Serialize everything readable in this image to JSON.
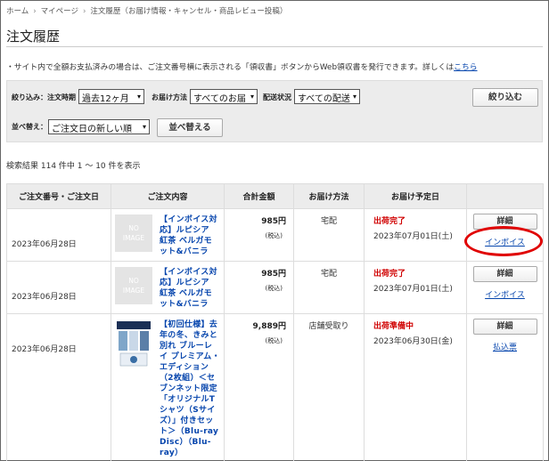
{
  "breadcrumb": {
    "home": "ホーム",
    "mypage": "マイページ",
    "current": "注文履歴（お届け情報・キャンセル・商品レビュー投稿）"
  },
  "page_title": "注文履歴",
  "notice": {
    "text": "・サイト内で全額お支払済みの場合は、ご注文番号横に表示される「領収書」ボタンからWeb領収書を発行できます。詳しくは",
    "link": "こちら"
  },
  "filter": {
    "label": "絞り込み：",
    "period_label": "注文時期",
    "period_value": "過去12ヶ月",
    "method_label": "お届け方法",
    "method_value": "すべてのお届",
    "status_label": "配送状況",
    "status_value": "すべての配送",
    "apply_label": "絞り込む",
    "sort_label": "並べ替え：",
    "sort_value": "ご注文日の新しい順",
    "sort_button": "並べ替える"
  },
  "result_count": "検索結果 114 件中 1 〜 10 件を表示",
  "table": {
    "headers": [
      "ご注文番号・ご注文日",
      "ご注文内容",
      "合計金額",
      "お届け方法",
      "お届け予定日",
      ""
    ],
    "rows": [
      {
        "date": "2023年06月28日",
        "image": "NO IMAGE",
        "item": "【インボイス対応】ルピシア 紅茶 ベルガモット&バニラ",
        "price": "985円",
        "tax": "(税込)",
        "method": "宅配",
        "status": "出荷完了",
        "delivery": "2023年07月01日(土)",
        "detail_label": "詳細",
        "link_label": "インボイス"
      },
      {
        "date": "2023年06月28日",
        "image": "NO IMAGE",
        "item": "【インボイス対応】ルピシア 紅茶 ベルガモット&バニラ",
        "price": "985円",
        "tax": "(税込)",
        "method": "宅配",
        "status": "出荷完了",
        "delivery": "2023年07月01日(土)",
        "detail_label": "詳細",
        "link_label": "インボイス"
      },
      {
        "date": "2023年06月28日",
        "image": "",
        "item": "【初回仕様】去年の冬、きみと別れ ブルーレイ プレミアム・エディション（2枚組）＜セブンネット限定「オリジナルTシャツ（Sサイズ）」付きセット＞（Blu-ray Disc）（Blu-ray）",
        "price": "9,889円",
        "tax": "(税込)",
        "method": "店舗受取り",
        "status": "出荷準備中",
        "delivery": "2023年06月30日(金)",
        "detail_label": "詳細",
        "link_label": "払込票"
      }
    ]
  },
  "colors": {
    "status": "#d00000",
    "link": "#0645ad",
    "highlight_ring": "#e00000"
  }
}
